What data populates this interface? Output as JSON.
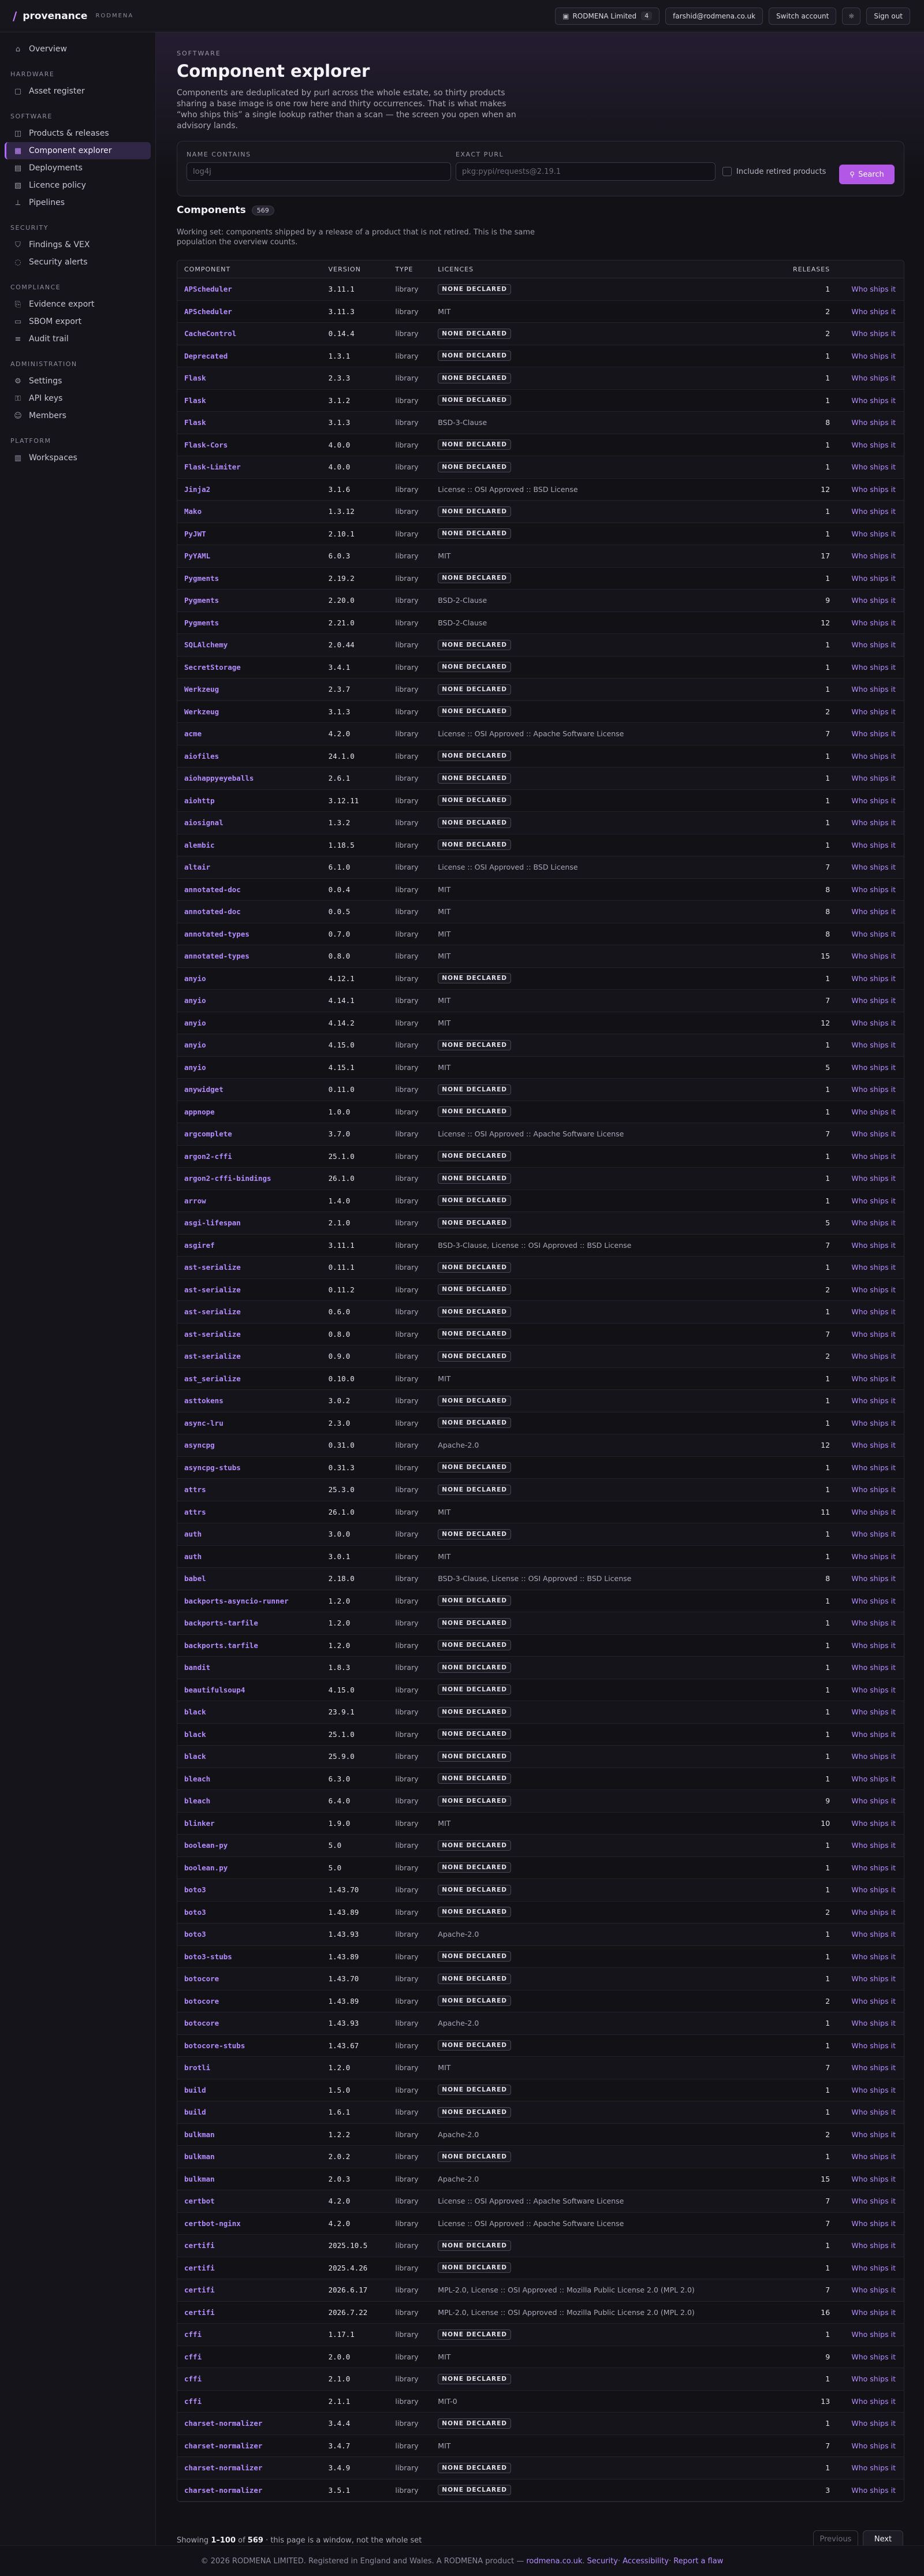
{
  "topbar": {
    "brand": "provenance",
    "tenant": "RODMENA",
    "org_name": "RODMENA Limited",
    "org_count": "4",
    "user_email": "farshid@rodmena.co.uk",
    "switch_label": "Switch account",
    "signout_label": "Sign out"
  },
  "sidebar": {
    "overview": "Overview",
    "sections": [
      {
        "title": "HARDWARE",
        "items": [
          {
            "label": "Asset register",
            "icon": "box-icon"
          }
        ]
      },
      {
        "title": "SOFTWARE",
        "items": [
          {
            "label": "Products & releases",
            "icon": "package-icon"
          },
          {
            "label": "Component explorer",
            "icon": "grid-icon",
            "active": true
          },
          {
            "label": "Deployments",
            "icon": "deploy-icon"
          },
          {
            "label": "Licence policy",
            "icon": "policy-icon"
          },
          {
            "label": "Pipelines",
            "icon": "pipeline-icon"
          }
        ]
      },
      {
        "title": "SECURITY",
        "items": [
          {
            "label": "Findings & VEX",
            "icon": "shield-icon"
          },
          {
            "label": "Security alerts",
            "icon": "alert-icon"
          }
        ]
      },
      {
        "title": "COMPLIANCE",
        "items": [
          {
            "label": "Evidence export",
            "icon": "export-icon"
          },
          {
            "label": "SBOM export",
            "icon": "file-icon"
          },
          {
            "label": "Audit trail",
            "icon": "trail-icon"
          }
        ]
      },
      {
        "title": "ADMINISTRATION",
        "items": [
          {
            "label": "Settings",
            "icon": "gear-icon"
          },
          {
            "label": "API keys",
            "icon": "key-icon"
          },
          {
            "label": "Members",
            "icon": "users-icon"
          }
        ]
      },
      {
        "title": "PLATFORM",
        "items": [
          {
            "label": "Workspaces",
            "icon": "workspace-icon"
          }
        ]
      }
    ]
  },
  "page": {
    "eyebrow": "SOFTWARE",
    "title": "Component explorer",
    "description": "Components are deduplicated by purl across the whole estate, so thirty products sharing a base image is one row here and thirty occurrences. That is what makes “who ships this” a single lookup rather than a scan — the screen you open when an advisory lands."
  },
  "filters": {
    "name_label": "NAME CONTAINS",
    "name_placeholder": "log4j",
    "purl_label": "EXACT PURL",
    "purl_placeholder": "pkg:pypi/requests@2.19.1",
    "retired_label": "Include retired products",
    "search_label": "Search"
  },
  "components": {
    "title": "Components",
    "count": "569",
    "note": "Working set: components shipped by a release of a product that is not retired. This is the same population the overview counts.",
    "headers": {
      "component": "COMPONENT",
      "version": "VERSION",
      "type": "TYPE",
      "licences": "LICENCES",
      "releases": "RELEASES"
    },
    "action_label": "Who ships it",
    "none_label": "NONE DECLARED"
  },
  "rows": [
    [
      "APScheduler",
      "3.11.1",
      "library",
      "",
      1
    ],
    [
      "APScheduler",
      "3.11.3",
      "library",
      "MIT",
      2
    ],
    [
      "CacheControl",
      "0.14.4",
      "library",
      "",
      2
    ],
    [
      "Deprecated",
      "1.3.1",
      "library",
      "",
      1
    ],
    [
      "Flask",
      "2.3.3",
      "library",
      "",
      1
    ],
    [
      "Flask",
      "3.1.2",
      "library",
      "",
      1
    ],
    [
      "Flask",
      "3.1.3",
      "library",
      "BSD-3-Clause",
      8
    ],
    [
      "Flask-Cors",
      "4.0.0",
      "library",
      "",
      1
    ],
    [
      "Flask-Limiter",
      "4.0.0",
      "library",
      "",
      1
    ],
    [
      "Jinja2",
      "3.1.6",
      "library",
      "License :: OSI Approved :: BSD License",
      12
    ],
    [
      "Mako",
      "1.3.12",
      "library",
      "",
      1
    ],
    [
      "PyJWT",
      "2.10.1",
      "library",
      "",
      1
    ],
    [
      "PyYAML",
      "6.0.3",
      "library",
      "MIT",
      17
    ],
    [
      "Pygments",
      "2.19.2",
      "library",
      "",
      1
    ],
    [
      "Pygments",
      "2.20.0",
      "library",
      "BSD-2-Clause",
      9
    ],
    [
      "Pygments",
      "2.21.0",
      "library",
      "BSD-2-Clause",
      12
    ],
    [
      "SQLAlchemy",
      "2.0.44",
      "library",
      "",
      1
    ],
    [
      "SecretStorage",
      "3.4.1",
      "library",
      "",
      1
    ],
    [
      "Werkzeug",
      "2.3.7",
      "library",
      "",
      1
    ],
    [
      "Werkzeug",
      "3.1.3",
      "library",
      "",
      2
    ],
    [
      "acme",
      "4.2.0",
      "library",
      "License :: OSI Approved :: Apache Software License",
      7
    ],
    [
      "aiofiles",
      "24.1.0",
      "library",
      "",
      1
    ],
    [
      "aiohappyeyeballs",
      "2.6.1",
      "library",
      "",
      1
    ],
    [
      "aiohttp",
      "3.12.11",
      "library",
      "",
      1
    ],
    [
      "aiosignal",
      "1.3.2",
      "library",
      "",
      1
    ],
    [
      "alembic",
      "1.18.5",
      "library",
      "",
      1
    ],
    [
      "altair",
      "6.1.0",
      "library",
      "License :: OSI Approved :: BSD License",
      7
    ],
    [
      "annotated-doc",
      "0.0.4",
      "library",
      "MIT",
      8
    ],
    [
      "annotated-doc",
      "0.0.5",
      "library",
      "MIT",
      8
    ],
    [
      "annotated-types",
      "0.7.0",
      "library",
      "MIT",
      8
    ],
    [
      "annotated-types",
      "0.8.0",
      "library",
      "MIT",
      15
    ],
    [
      "anyio",
      "4.12.1",
      "library",
      "",
      1
    ],
    [
      "anyio",
      "4.14.1",
      "library",
      "MIT",
      7
    ],
    [
      "anyio",
      "4.14.2",
      "library",
      "MIT",
      12
    ],
    [
      "anyio",
      "4.15.0",
      "library",
      "",
      1
    ],
    [
      "anyio",
      "4.15.1",
      "library",
      "MIT",
      5
    ],
    [
      "anywidget",
      "0.11.0",
      "library",
      "",
      1
    ],
    [
      "appnope",
      "1.0.0",
      "library",
      "",
      1
    ],
    [
      "argcomplete",
      "3.7.0",
      "library",
      "License :: OSI Approved :: Apache Software License",
      7
    ],
    [
      "argon2-cffi",
      "25.1.0",
      "library",
      "",
      1
    ],
    [
      "argon2-cffi-bindings",
      "26.1.0",
      "library",
      "",
      1
    ],
    [
      "arrow",
      "1.4.0",
      "library",
      "",
      1
    ],
    [
      "asgi-lifespan",
      "2.1.0",
      "library",
      "",
      5
    ],
    [
      "asgiref",
      "3.11.1",
      "library",
      "BSD-3-Clause, License :: OSI Approved :: BSD License",
      7
    ],
    [
      "ast-serialize",
      "0.11.1",
      "library",
      "",
      1
    ],
    [
      "ast-serialize",
      "0.11.2",
      "library",
      "",
      2
    ],
    [
      "ast-serialize",
      "0.6.0",
      "library",
      "",
      1
    ],
    [
      "ast-serialize",
      "0.8.0",
      "library",
      "",
      7
    ],
    [
      "ast-serialize",
      "0.9.0",
      "library",
      "",
      2
    ],
    [
      "ast_serialize",
      "0.10.0",
      "library",
      "MIT",
      1
    ],
    [
      "asttokens",
      "3.0.2",
      "library",
      "",
      1
    ],
    [
      "async-lru",
      "2.3.0",
      "library",
      "",
      1
    ],
    [
      "asyncpg",
      "0.31.0",
      "library",
      "Apache-2.0",
      12
    ],
    [
      "asyncpg-stubs",
      "0.31.3",
      "library",
      "",
      1
    ],
    [
      "attrs",
      "25.3.0",
      "library",
      "",
      1
    ],
    [
      "attrs",
      "26.1.0",
      "library",
      "MIT",
      11
    ],
    [
      "auth",
      "3.0.0",
      "library",
      "",
      1
    ],
    [
      "auth",
      "3.0.1",
      "library",
      "MIT",
      1
    ],
    [
      "babel",
      "2.18.0",
      "library",
      "BSD-3-Clause, License :: OSI Approved :: BSD License",
      8
    ],
    [
      "backports-asyncio-runner",
      "1.2.0",
      "library",
      "",
      1
    ],
    [
      "backports-tarfile",
      "1.2.0",
      "library",
      "",
      1
    ],
    [
      "backports.tarfile",
      "1.2.0",
      "library",
      "",
      1
    ],
    [
      "bandit",
      "1.8.3",
      "library",
      "",
      1
    ],
    [
      "beautifulsoup4",
      "4.15.0",
      "library",
      "",
      1
    ],
    [
      "black",
      "23.9.1",
      "library",
      "",
      1
    ],
    [
      "black",
      "25.1.0",
      "library",
      "",
      1
    ],
    [
      "black",
      "25.9.0",
      "library",
      "",
      1
    ],
    [
      "bleach",
      "6.3.0",
      "library",
      "",
      1
    ],
    [
      "bleach",
      "6.4.0",
      "library",
      "",
      9
    ],
    [
      "blinker",
      "1.9.0",
      "library",
      "MIT",
      10
    ],
    [
      "boolean-py",
      "5.0",
      "library",
      "",
      1
    ],
    [
      "boolean.py",
      "5.0",
      "library",
      "",
      1
    ],
    [
      "boto3",
      "1.43.70",
      "library",
      "",
      1
    ],
    [
      "boto3",
      "1.43.89",
      "library",
      "",
      2
    ],
    [
      "boto3",
      "1.43.93",
      "library",
      "Apache-2.0",
      1
    ],
    [
      "boto3-stubs",
      "1.43.89",
      "library",
      "",
      1
    ],
    [
      "botocore",
      "1.43.70",
      "library",
      "",
      1
    ],
    [
      "botocore",
      "1.43.89",
      "library",
      "",
      2
    ],
    [
      "botocore",
      "1.43.93",
      "library",
      "Apache-2.0",
      1
    ],
    [
      "botocore-stubs",
      "1.43.67",
      "library",
      "",
      1
    ],
    [
      "brotli",
      "1.2.0",
      "library",
      "MIT",
      7
    ],
    [
      "build",
      "1.5.0",
      "library",
      "",
      1
    ],
    [
      "build",
      "1.6.1",
      "library",
      "",
      1
    ],
    [
      "bulkman",
      "1.2.2",
      "library",
      "Apache-2.0",
      2
    ],
    [
      "bulkman",
      "2.0.2",
      "library",
      "",
      1
    ],
    [
      "bulkman",
      "2.0.3",
      "library",
      "Apache-2.0",
      15
    ],
    [
      "certbot",
      "4.2.0",
      "library",
      "License :: OSI Approved :: Apache Software License",
      7
    ],
    [
      "certbot-nginx",
      "4.2.0",
      "library",
      "License :: OSI Approved :: Apache Software License",
      7
    ],
    [
      "certifi",
      "2025.10.5",
      "library",
      "",
      1
    ],
    [
      "certifi",
      "2025.4.26",
      "library",
      "",
      1
    ],
    [
      "certifi",
      "2026.6.17",
      "library",
      "MPL-2.0, License :: OSI Approved :: Mozilla Public License 2.0 (MPL 2.0)",
      7
    ],
    [
      "certifi",
      "2026.7.22",
      "library",
      "MPL-2.0, License :: OSI Approved :: Mozilla Public License 2.0 (MPL 2.0)",
      16
    ],
    [
      "cffi",
      "1.17.1",
      "library",
      "",
      1
    ],
    [
      "cffi",
      "2.0.0",
      "library",
      "MIT",
      9
    ],
    [
      "cffi",
      "2.1.0",
      "library",
      "",
      1
    ],
    [
      "cffi",
      "2.1.1",
      "library",
      "MIT-0",
      13
    ],
    [
      "charset-normalizer",
      "3.4.4",
      "library",
      "",
      1
    ],
    [
      "charset-normalizer",
      "3.4.7",
      "library",
      "MIT",
      7
    ],
    [
      "charset-normalizer",
      "3.4.9",
      "library",
      "",
      1
    ],
    [
      "charset-normalizer",
      "3.5.1",
      "library",
      "",
      3
    ]
  ],
  "pager": {
    "prefix": "Showing ",
    "range": "1–100",
    "of": " of ",
    "total": "569",
    "suffix": " · this page is a window, not the whole set",
    "prev_label": "Previous",
    "next_label": "Next"
  },
  "footer": {
    "text": "© 2026 RODMENA LIMITED. Registered in England and Wales. A RODMENA product —",
    "link_site": "rodmena.co.uk",
    "link_security": "Security",
    "link_accessibility": "Accessibility",
    "link_flaw": "Report a flaw"
  }
}
